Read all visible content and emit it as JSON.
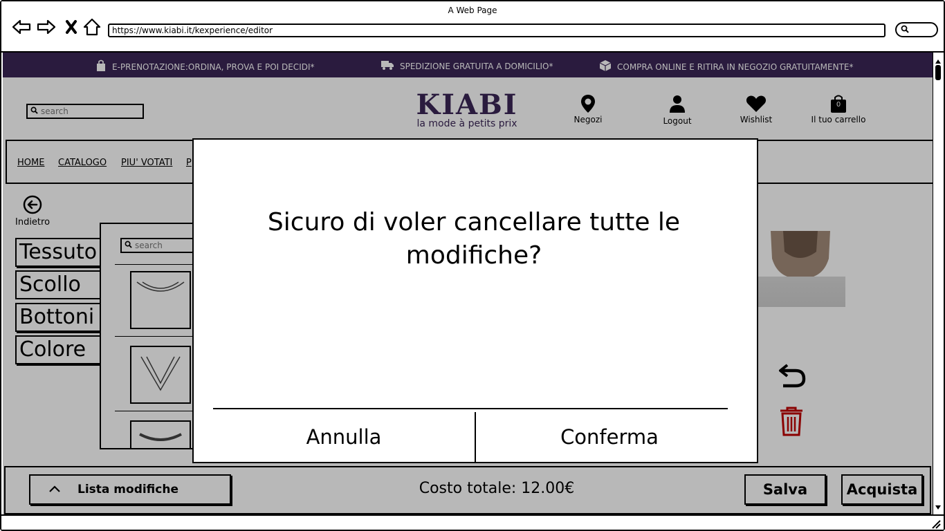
{
  "browser": {
    "window_title": "A Web Page",
    "url": "https://www.kiabi.it/kexperience/editor"
  },
  "promo": [
    {
      "icon": "bag-icon",
      "text": "E-PRENOTAZIONE:ORDINA, PROVA E POI DECIDI*"
    },
    {
      "icon": "truck-icon",
      "text": "SPEDIZIONE GRATUITA A DOMICILIO*"
    },
    {
      "icon": "box-icon",
      "text": "COMPRA ONLINE E RITIRA IN NEGOZIO GRATUITAMENTE*"
    }
  ],
  "header": {
    "search_placeholder": "search",
    "logo_main": "KIABI",
    "logo_sub": "la mode à petits prix",
    "links": [
      {
        "icon": "location-pin-icon",
        "label": "Negozi"
      },
      {
        "icon": "user-icon",
        "label": "Logout"
      },
      {
        "icon": "heart-icon",
        "label": "Wishlist"
      },
      {
        "icon": "cart-icon",
        "label": "Il tuo carrello",
        "badge": "0"
      }
    ]
  },
  "nav": {
    "items": [
      "HOME",
      "CATALOGO",
      "PIU' VOTATI",
      "P"
    ]
  },
  "editor": {
    "back_label": "Indietro",
    "categories": [
      "Tessuto",
      "Scollo",
      "Bottoni",
      "Colore"
    ],
    "options_search_placeholder": "search"
  },
  "bottom_bar": {
    "list_button": "Lista modifiche",
    "total_label": "Costo totale: 12.00€",
    "save_button": "Salva",
    "buy_button": "Acquista"
  },
  "modal": {
    "message": "Sicuro di voler cancellare tutte le modifiche?",
    "cancel_button": "Annulla",
    "confirm_button": "Conferma"
  },
  "colors": {
    "brand_purple": "#3b2657",
    "trash_red": "#c00000"
  }
}
